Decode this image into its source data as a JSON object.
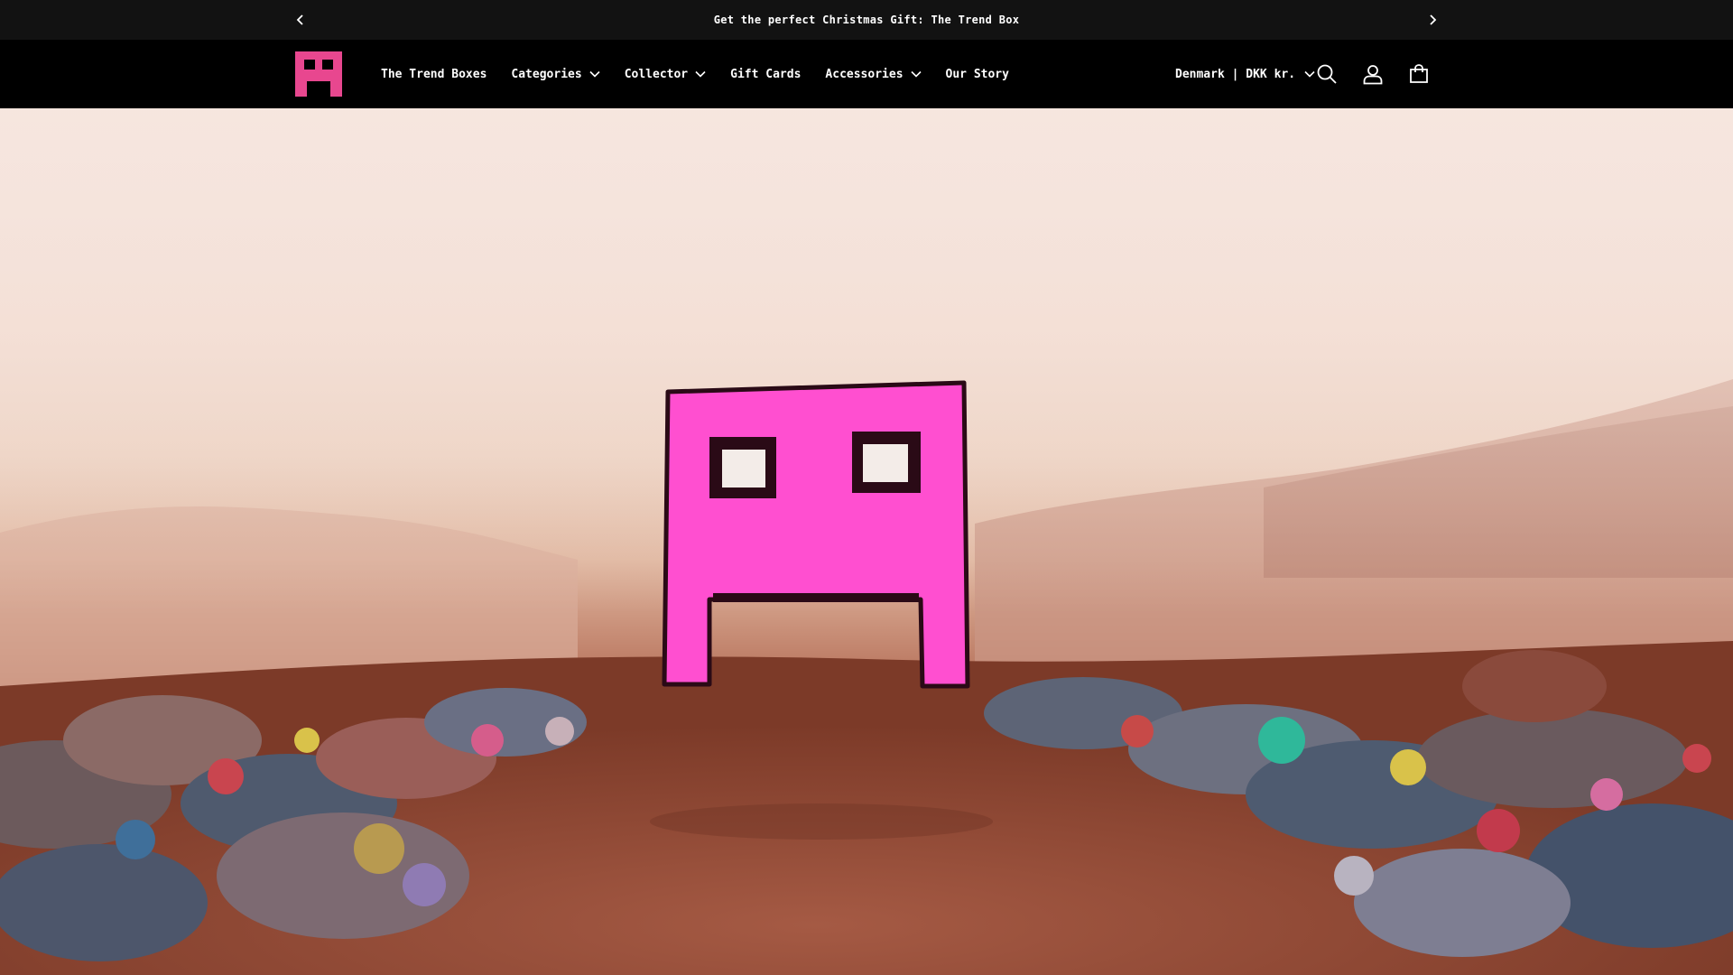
{
  "announcement": {
    "text": "Get the perfect Christmas Gift: The Trend Box"
  },
  "nav": {
    "items": [
      {
        "label": "The Trend Boxes",
        "dropdown": false
      },
      {
        "label": "Categories",
        "dropdown": true
      },
      {
        "label": "Collector",
        "dropdown": true
      },
      {
        "label": "Gift Cards",
        "dropdown": false
      },
      {
        "label": "Accessories",
        "dropdown": true
      },
      {
        "label": "Our Story",
        "dropdown": false
      }
    ]
  },
  "header": {
    "country_label": "Denmark | DKK kr."
  },
  "colors": {
    "brand_pink": "#ff4fb8",
    "logo_pink": "#e8478f",
    "announcement_bg": "#121212",
    "header_bg": "#000000"
  },
  "icons": {
    "prev": "chevron-left-icon",
    "next": "chevron-right-icon",
    "search": "search-icon",
    "account": "account-icon",
    "cart": "cart-icon"
  }
}
